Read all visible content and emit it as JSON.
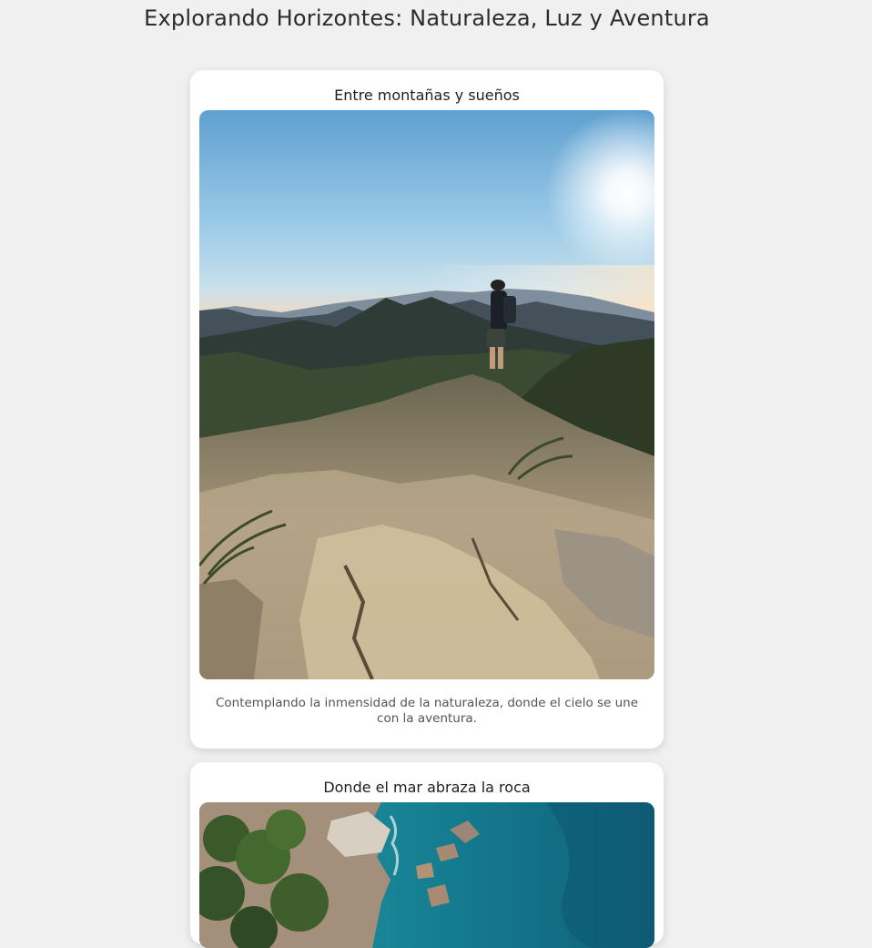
{
  "page": {
    "title": "Explorando Horizontes: Naturaleza, Luz y Aventura"
  },
  "cards": [
    {
      "title": "Entre montañas y sueños",
      "image": "hiker-on-mountain-summit-at-sunrise",
      "caption": "Contemplando la inmensidad de la naturaleza, donde el cielo se une con la aventura."
    },
    {
      "title": "Donde el mar abraza la roca",
      "image": "aerial-view-of-rocky-coast-and-turquoise-sea"
    }
  ],
  "colors": {
    "background": "#f0f0f0",
    "card": "#ffffff",
    "title_text": "#2b2b2b",
    "caption_text": "#555555"
  }
}
